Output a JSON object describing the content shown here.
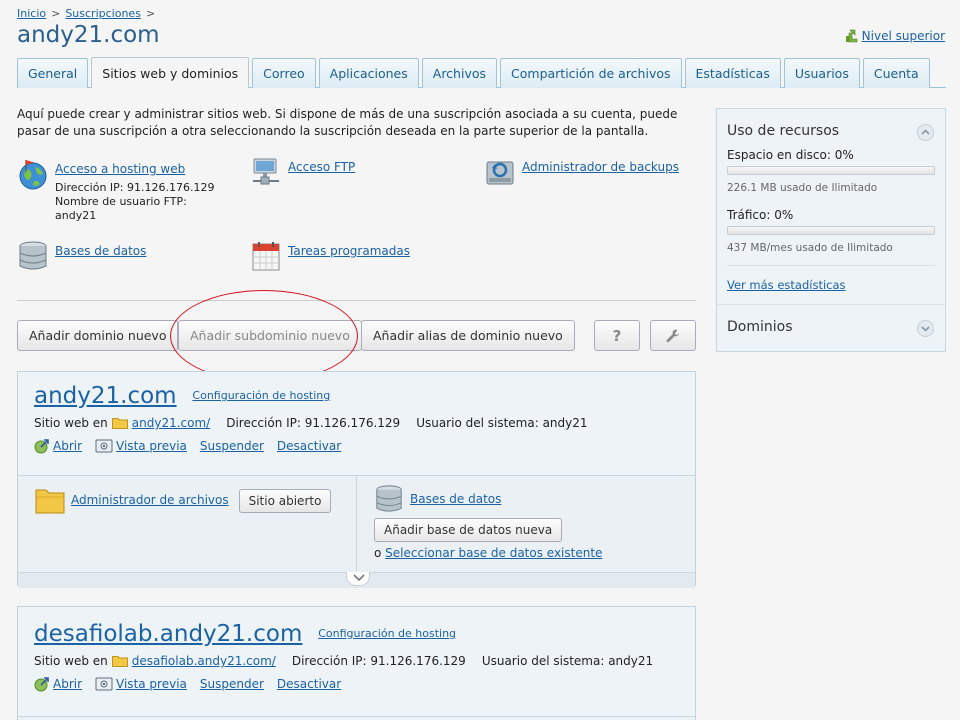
{
  "breadcrumb": {
    "home": "Inicio",
    "subscriptions": "Suscripciones",
    "separator": ">"
  },
  "page_title": "andy21.com",
  "up_level": "Nivel superior",
  "tabs": [
    {
      "label": "General"
    },
    {
      "label": "Sitios web y dominios",
      "active": true
    },
    {
      "label": "Correo"
    },
    {
      "label": "Aplicaciones"
    },
    {
      "label": "Archivos"
    },
    {
      "label": "Compartición de archivos"
    },
    {
      "label": "Estadísticas"
    },
    {
      "label": "Usuarios"
    },
    {
      "label": "Cuenta"
    }
  ],
  "intro": "Aquí puede crear y administrar sitios web. Si dispone de más de una suscripción asociada a su cuenta, puede pasar de una suscripción a otra seleccionando la suscripción deseada en la parte superior de la pantalla.",
  "tools": {
    "hosting_access": "Acceso a hosting web",
    "ip_address": "Dirección IP: 91.126.176.129",
    "ftp_user_label": "Nombre de usuario FTP:",
    "ftp_user": "andy21",
    "ftp_access": "Acceso FTP",
    "backup_manager": "Administrador de backups",
    "databases": "Bases de datos",
    "scheduled_tasks": "Tareas programadas"
  },
  "buttons": {
    "add_domain": "Añadir dominio nuevo",
    "add_subdomain": "Añadir subdominio nuevo",
    "add_alias": "Añadir alias de dominio nuevo",
    "help": "?"
  },
  "sites": [
    {
      "name": "andy21.com",
      "hosting_config": "Configuración de hosting",
      "site_at": "Sitio web en",
      "folder": "andy21.com/",
      "ip": "Dirección IP: 91.126.176.129",
      "system_user": "Usuario del sistema: andy21",
      "actions": {
        "open": "Abrir",
        "preview": "Vista previa",
        "suspend": "Suspender",
        "disable": "Desactivar"
      },
      "file_manager": "Administrador de archivos",
      "open_site": "Sitio abierto",
      "databases": "Bases de datos",
      "add_db": "Añadir base de datos nueva",
      "select_db_prefix": "o",
      "select_db": "Seleccionar base de datos existente"
    },
    {
      "name": "desafiolab.andy21.com",
      "hosting_config": "Configuración de hosting",
      "site_at": "Sitio web en",
      "folder": "desafiolab.andy21.com/",
      "ip": "Dirección IP: 91.126.176.129",
      "system_user": "Usuario del sistema: andy21",
      "actions": {
        "open": "Abrir",
        "preview": "Vista previa",
        "suspend": "Suspender",
        "disable": "Desactivar"
      }
    }
  ],
  "sidebar": {
    "resources_title": "Uso de recursos",
    "disk_label": "Espacio en disco: 0%",
    "disk_usage_fraction": 0,
    "disk_sub": "226.1 MB usado de Ilimitado",
    "traffic_label": "Tráfico: 0%",
    "traffic_usage_fraction": 0,
    "traffic_sub": "437 MB/mes usado de Ilimitado",
    "more_stats": "Ver más estadísticas",
    "domains_title": "Dominios"
  },
  "colors": {
    "link": "#1a62a6",
    "title": "#2a5f8f",
    "annotation_circle": "#d0121c"
  }
}
